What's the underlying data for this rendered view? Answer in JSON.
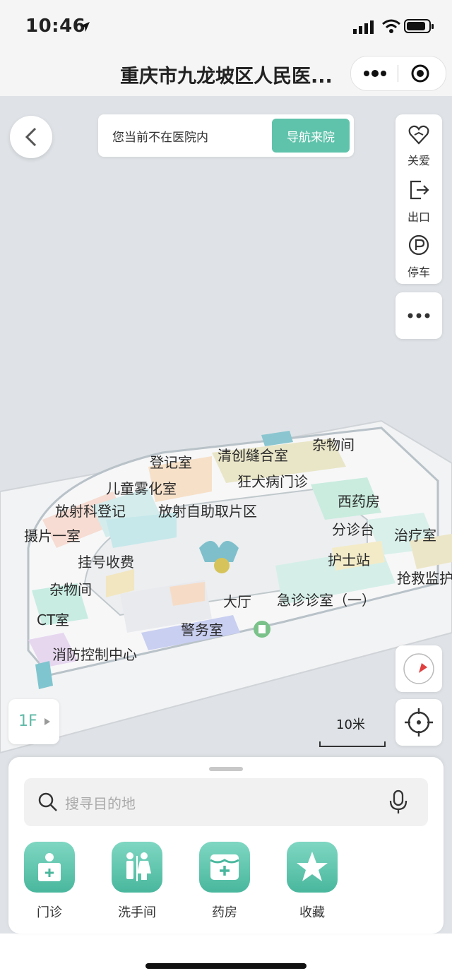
{
  "status": {
    "time": "10:46"
  },
  "header": {
    "title": "重庆市九龙坡区人民医..."
  },
  "notice": {
    "text": "您当前不在医院内",
    "button": "导航来院"
  },
  "side_tools": [
    {
      "label": "关爱",
      "icon": "care-heart-icon"
    },
    {
      "label": "出口",
      "icon": "exit-icon"
    },
    {
      "label": "停车",
      "icon": "parking-icon"
    }
  ],
  "map": {
    "floor": "1F",
    "scale": "10米",
    "labels": [
      "登记室",
      "清创缝合室",
      "杂物间",
      "儿童雾化室",
      "狂犬病门诊",
      "放射科登记",
      "放射自助取片区",
      "西药房",
      "摄片一室",
      "分诊台",
      "治疗室",
      "挂号收费",
      "护士站",
      "杂物间",
      "抢救监护",
      "大厅",
      "急诊诊室（一）",
      "CT室",
      "警务室",
      "消防控制中心"
    ]
  },
  "search": {
    "placeholder": "搜寻目的地"
  },
  "categories": [
    {
      "label": "门诊",
      "icon": "clinic-icon"
    },
    {
      "label": "洗手间",
      "icon": "restroom-icon"
    },
    {
      "label": "药房",
      "icon": "pharmacy-icon"
    },
    {
      "label": "收藏",
      "icon": "star-icon"
    }
  ],
  "colors": {
    "accent": "#5fc3ab"
  }
}
